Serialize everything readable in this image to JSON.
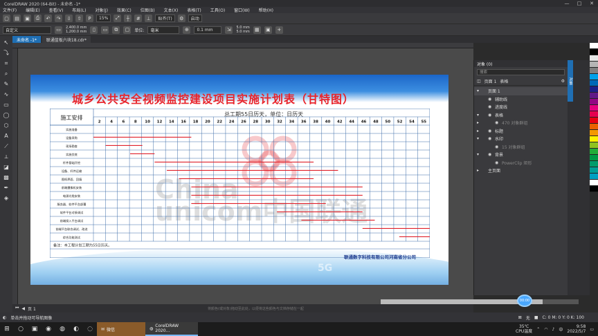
{
  "window": {
    "title": "CorelDRAW 2020 (64-Bit) - 未命名 -1*",
    "controls": [
      "—",
      "□",
      "✕"
    ]
  },
  "menu": [
    "文件(F)",
    "编辑(E)",
    "查看(V)",
    "布局(L)",
    "对象(J)",
    "效果(C)",
    "位图(B)",
    "文本(X)",
    "表格(T)",
    "工具(O)",
    "窗口(W)",
    "帮助(H)"
  ],
  "toolbar": {
    "zoom": "15%",
    "snap": "贴齐(T)",
    "launch": "启动"
  },
  "propbar": {
    "preset": "自定义",
    "width": "2,400.0 mm",
    "height": "1,200.0 mm",
    "unit_label": "单位:",
    "unit": "毫米",
    "nudge": "0.1 mm",
    "dup_x": "5.0 mm",
    "dup_y": "5.0 mm"
  },
  "tabs": [
    {
      "label": "未命名 -1*",
      "active": true
    },
    {
      "label": "联通蓝板六块18.cdr*",
      "active": false
    }
  ],
  "document": {
    "title": "城乡公共安全视频监控建设项目实施计划表（甘特图）",
    "subtitle": "总工期55日历天，单位：日历天",
    "watermark_lines": [
      "China",
      "unicom中国联通"
    ],
    "note": "备注：本工程计划工期为55日历天。",
    "company": "联通数字科技有限公司河南省分公司",
    "g5": "5G"
  },
  "chart_data": {
    "type": "table",
    "row_header_title": "施工安排",
    "columns": [
      "2",
      "4",
      "6",
      "8",
      "10",
      "12",
      "14",
      "16",
      "18",
      "20",
      "22",
      "24",
      "26",
      "28",
      "30",
      "32",
      "34",
      "36",
      "38",
      "40",
      "42",
      "44",
      "46",
      "48",
      "50",
      "52",
      "54",
      "55"
    ],
    "tasks": [
      {
        "name": "实施准备",
        "start": 0,
        "end": 0
      },
      {
        "name": "设备采购",
        "start": 0,
        "end": 16
      },
      {
        "name": "现场勘查",
        "start": 2,
        "end": 8
      },
      {
        "name": "实施交底",
        "start": 6,
        "end": 10
      },
      {
        "name": "杆件基础开挖",
        "start": 10,
        "end": 36
      },
      {
        "name": "设备、杆件运输",
        "start": 12,
        "end": 40
      },
      {
        "name": "图纸界面、回填",
        "start": 14,
        "end": 36
      },
      {
        "name": "前端摄像机安装",
        "start": 16,
        "end": 44
      },
      {
        "name": "电源光缆安装",
        "start": 16,
        "end": 44
      },
      {
        "name": "服务器、软件平台部署",
        "start": 16,
        "end": 38
      },
      {
        "name": "软件平台对接调试",
        "start": 30,
        "end": 44
      },
      {
        "name": "前端接入平台调试",
        "start": 34,
        "end": 46
      },
      {
        "name": "前端平台联合调试、改进",
        "start": 44,
        "end": 55
      },
      {
        "name": "综合功能测试",
        "start": 50,
        "end": 55
      }
    ]
  },
  "docker": {
    "title": "对象 (0)",
    "search_placeholder": "搜索",
    "page_label": "页面 1",
    "layer_label": "表格",
    "tree": [
      {
        "label": "页面 1",
        "level": 0,
        "arrow": "▾",
        "dim": false,
        "sel": true
      },
      {
        "label": "辅助线",
        "level": 1,
        "arrow": "",
        "dim": false,
        "sel": false
      },
      {
        "label": "进度线",
        "level": 1,
        "arrow": "",
        "dim": false,
        "sel": false
      },
      {
        "label": "表格",
        "level": 1,
        "arrow": "▾",
        "dim": false,
        "sel": false
      },
      {
        "label": "470 对象群组",
        "level": 2,
        "arrow": "▸",
        "dim": true,
        "sel": false
      },
      {
        "label": "标题",
        "level": 1,
        "arrow": "▸",
        "dim": false,
        "sel": false
      },
      {
        "label": "水印",
        "level": 1,
        "arrow": "▾",
        "dim": false,
        "sel": false
      },
      {
        "label": "15 对象群组",
        "level": 2,
        "arrow": "",
        "dim": true,
        "sel": false
      },
      {
        "label": "背景",
        "level": 1,
        "arrow": "▾",
        "dim": false,
        "sel": false
      },
      {
        "label": "PowerClip 矩形",
        "level": 2,
        "arrow": "",
        "dim": true,
        "sel": false
      },
      {
        "label": "主页面",
        "level": 0,
        "arrow": "▸",
        "dim": false,
        "sel": false
      }
    ],
    "side_tab": "对象"
  },
  "pagebar": {
    "page": "页 1",
    "hint": "将颜色(或对象)拖动至此处，以便将这些颜色与文档存储在一起"
  },
  "status": {
    "text": "单击并拖动可导航图像",
    "fill": "无",
    "cmyk": "C: 0 M: 0 Y: 0 K: 100",
    "zoom_badge": "00:00"
  },
  "palette": [
    "#ffffff",
    "#000000",
    "#e5e5e5",
    "#b5b5b5",
    "#7f7f7f",
    "#00a0e9",
    "#0068b7",
    "#1d2088",
    "#601986",
    "#920783",
    "#e4007f",
    "#e5004f",
    "#e60012",
    "#eb6100",
    "#f39800",
    "#fff100",
    "#8fc31f",
    "#22ac38",
    "#009944",
    "#009b6b",
    "#009e96",
    "#00a0c1",
    "#ffffff",
    "#000000"
  ],
  "taskbar": {
    "start": "⊞",
    "icons": [
      "○",
      "▣",
      "◉",
      "◍",
      "◐",
      "◌",
      "◎"
    ],
    "wechat": "微信",
    "corel": "CorelDRAW 2020...",
    "weather_temp": "35℃",
    "weather_label": "CPU温度",
    "ime": "中",
    "time": "9:58",
    "date": "2022/5/7"
  }
}
